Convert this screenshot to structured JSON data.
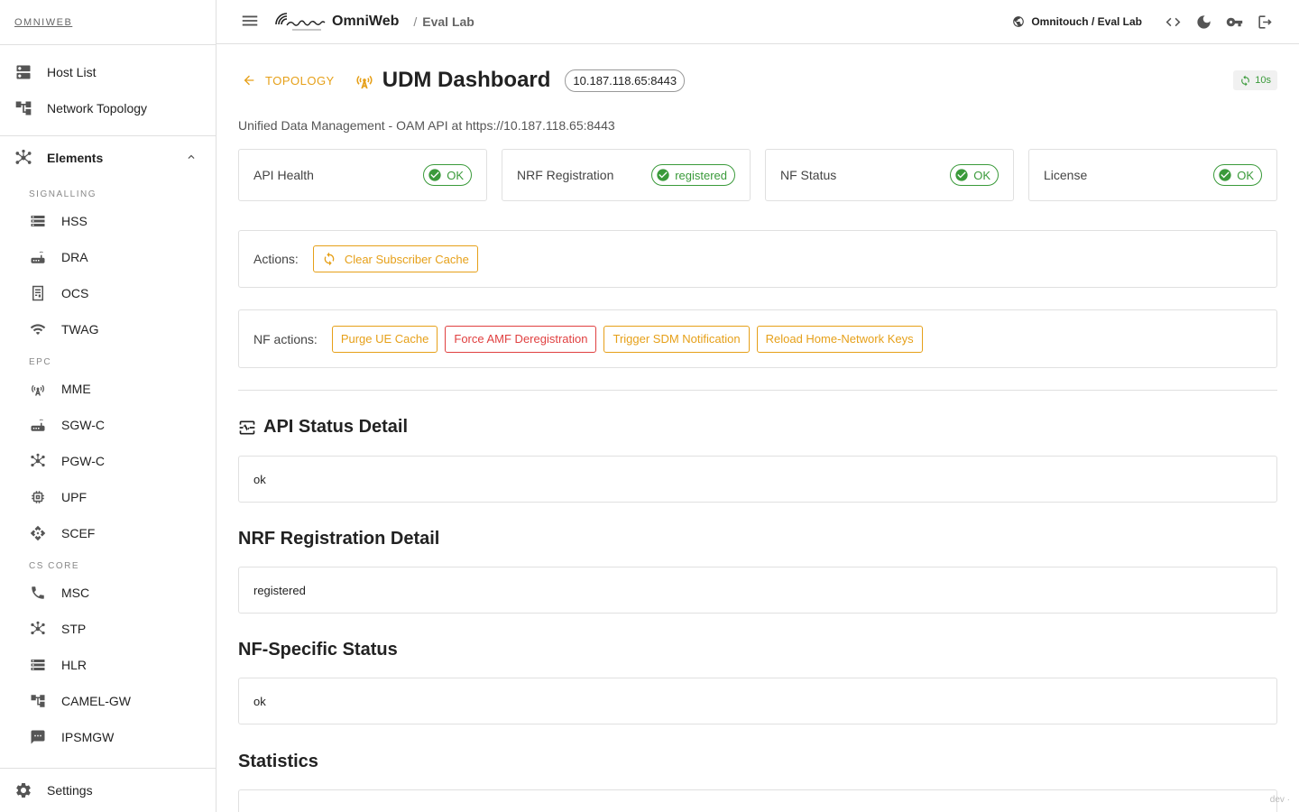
{
  "sidebar": {
    "brand": "OMNIWEB",
    "top_items": [
      {
        "label": "Host List",
        "icon": "dns-icon"
      },
      {
        "label": "Network Topology",
        "icon": "account-tree-icon"
      }
    ],
    "elements_label": "Elements",
    "groups": [
      {
        "label": "SIGNALLING",
        "items": [
          {
            "label": "HSS",
            "icon": "storage-icon"
          },
          {
            "label": "DRA",
            "icon": "router-icon"
          },
          {
            "label": "OCS",
            "icon": "receipt-icon"
          },
          {
            "label": "TWAG",
            "icon": "wifi-icon"
          }
        ]
      },
      {
        "label": "EPC",
        "items": [
          {
            "label": "MME",
            "icon": "cell-tower-icon"
          },
          {
            "label": "SGW-C",
            "icon": "router-icon"
          },
          {
            "label": "PGW-C",
            "icon": "hub-icon"
          },
          {
            "label": "UPF",
            "icon": "memory-icon"
          },
          {
            "label": "SCEF",
            "icon": "api-icon"
          }
        ]
      },
      {
        "label": "CS CORE",
        "items": [
          {
            "label": "MSC",
            "icon": "phone-icon"
          },
          {
            "label": "STP",
            "icon": "hub-icon"
          },
          {
            "label": "HLR",
            "icon": "storage-icon"
          },
          {
            "label": "CAMEL-GW",
            "icon": "account-tree-icon"
          },
          {
            "label": "IPSMGW",
            "icon": "sms-icon"
          }
        ]
      }
    ],
    "settings_label": "Settings"
  },
  "header": {
    "app_name": "OmniWeb",
    "breadcrumb_sep": "/",
    "breadcrumb": "Eval Lab",
    "tenant": "Omnitouch / Eval Lab"
  },
  "main": {
    "back_label": "TOPOLOGY",
    "title": "UDM Dashboard",
    "address": "10.187.118.65:8443",
    "refresh": "10s",
    "subtitle": "Unified Data Management - OAM API at https://10.187.118.65:8443",
    "status_cards": [
      {
        "label": "API Health",
        "value": "OK"
      },
      {
        "label": "NRF Registration",
        "value": "registered"
      },
      {
        "label": "NF Status",
        "value": "OK"
      },
      {
        "label": "License",
        "value": "OK"
      }
    ],
    "actions_label": "Actions:",
    "clear_cache_label": "Clear Subscriber Cache",
    "nf_actions_label": "NF actions:",
    "nf_buttons": [
      {
        "label": "Purge UE Cache",
        "variant": "warning"
      },
      {
        "label": "Force AMF Deregistration",
        "variant": "danger"
      },
      {
        "label": "Trigger SDM Notification",
        "variant": "warning"
      },
      {
        "label": "Reload Home-Network Keys",
        "variant": "warning"
      }
    ],
    "sections": [
      {
        "title": "API Status Detail",
        "value": "ok"
      },
      {
        "title": "NRF Registration Detail",
        "value": "registered"
      },
      {
        "title": "NF-Specific Status",
        "value": "ok"
      },
      {
        "title": "Statistics",
        "value": ""
      }
    ],
    "dev_tag": "dev ·"
  },
  "colors": {
    "accent": "#e6a019",
    "success": "#3a9a3a",
    "danger": "#e04040",
    "border": "#e0e0e0"
  }
}
